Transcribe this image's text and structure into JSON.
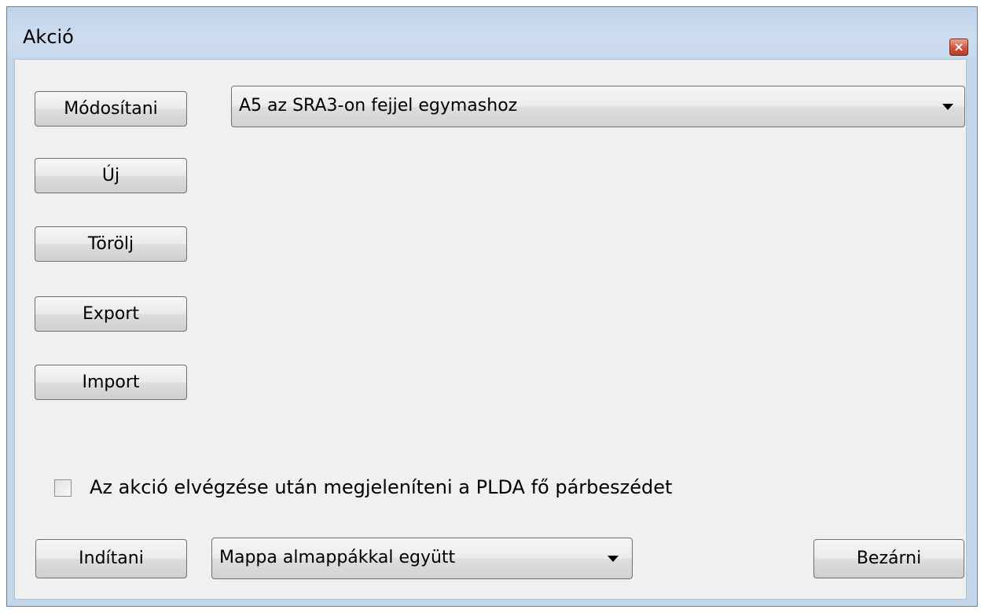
{
  "window": {
    "title": "Akció",
    "close_icon": "close-icon"
  },
  "buttons": {
    "modify": "Módosítani",
    "new": "Új",
    "delete": "Törölj",
    "export": "Export",
    "import": "Import",
    "start": "Indítani",
    "close": "Bezárni"
  },
  "action_combo": {
    "selected": "A5 az SRA3-on fejjel egymashoz"
  },
  "checkbox": {
    "label": "Az akció elvégzése után megjeleníteni a PLDA fő párbeszédet",
    "checked": false
  },
  "scope_combo": {
    "selected": "Mappa almappákkal együtt"
  }
}
